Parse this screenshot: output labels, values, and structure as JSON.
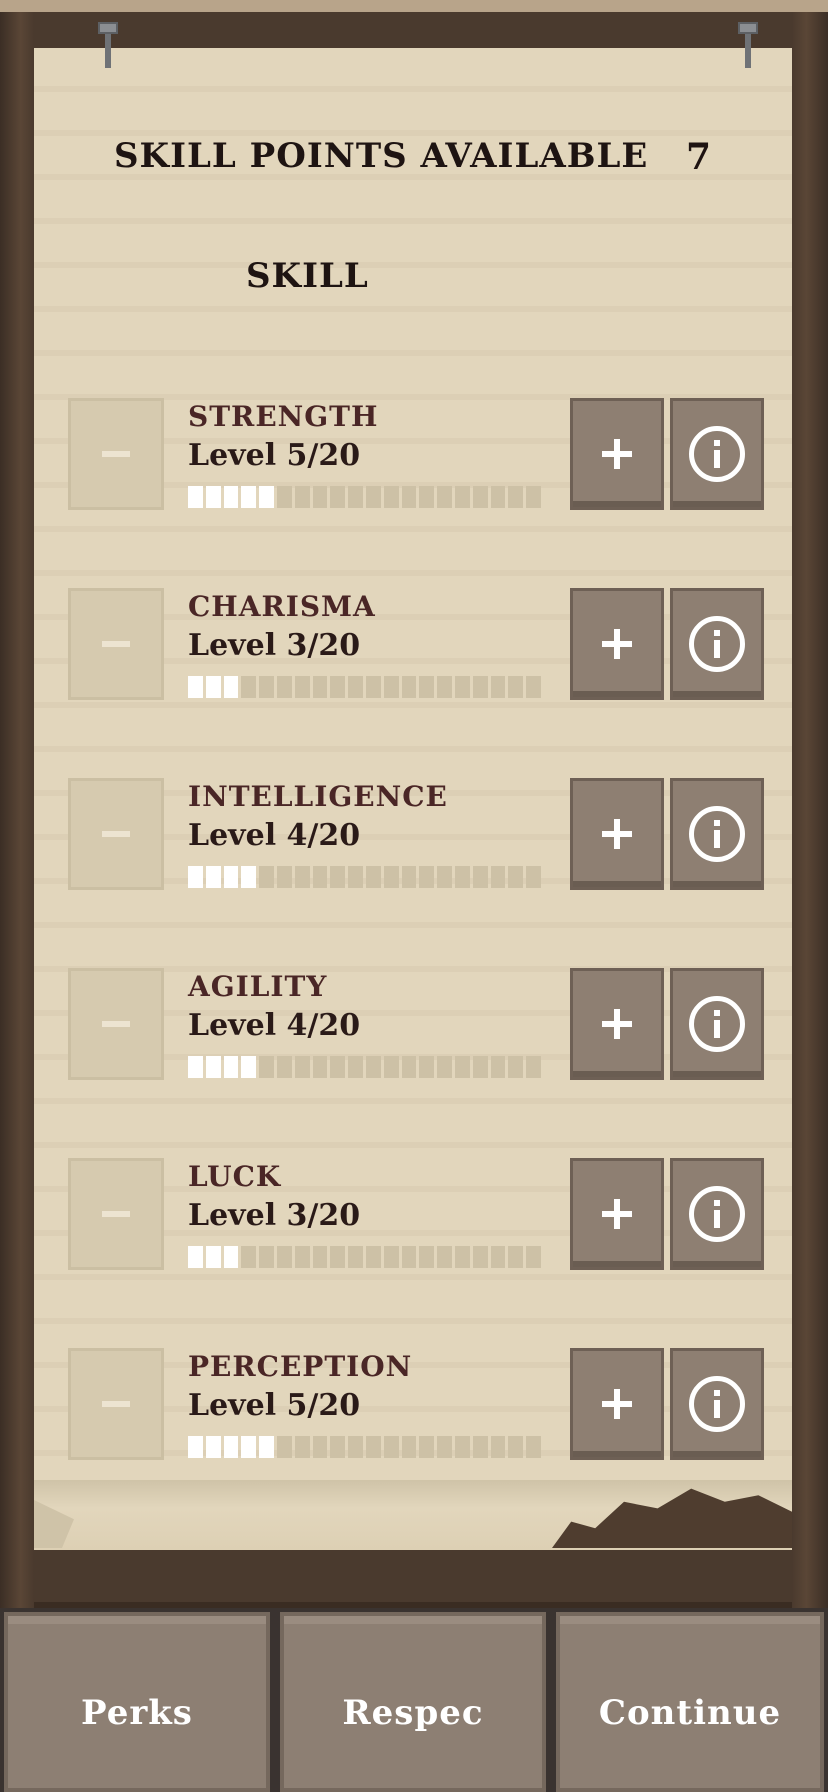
{
  "header": {
    "skill_points_label": "SKILL POINTS AVAILABLE",
    "skill_points_value": "7",
    "skill_heading": "SKILL"
  },
  "skills": [
    {
      "name": "STRENGTH",
      "level_text": "Level 5/20",
      "level": 5,
      "max": 20
    },
    {
      "name": "CHARISMA",
      "level_text": "Level 3/20",
      "level": 3,
      "max": 20
    },
    {
      "name": "INTELLIGENCE",
      "level_text": "Level 4/20",
      "level": 4,
      "max": 20
    },
    {
      "name": "AGILITY",
      "level_text": "Level 4/20",
      "level": 4,
      "max": 20
    },
    {
      "name": "LUCK",
      "level_text": "Level 3/20",
      "level": 3,
      "max": 20
    },
    {
      "name": "PERCEPTION",
      "level_text": "Level 5/20",
      "level": 5,
      "max": 20
    }
  ],
  "icons": {
    "minus": "minus-icon",
    "plus": "plus-icon",
    "info": "info-icon"
  },
  "bottom_bar": {
    "perks_label": "Perks",
    "respec_label": "Respec",
    "continue_label": "Continue"
  },
  "colors": {
    "parchment": "#e2d6bc",
    "button": "#8e7f72",
    "skill_name": "#4a2626",
    "level_bar_filled": "#ffffff",
    "level_bar_empty": "#cdc1a6"
  }
}
